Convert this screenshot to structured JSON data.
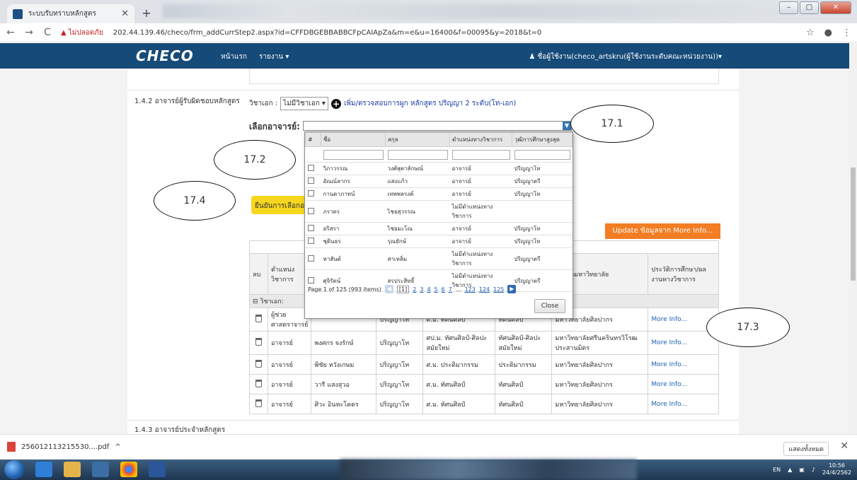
{
  "browser": {
    "tab_title": "ระบบรับทราบหลักสูตร",
    "security_label": "ไม่ปลอดภัย",
    "url": "202.44.139.46/checo/frm_addCurrStep2.aspx?id=CFFDBGEBBABBCFpCAIApZa&m=e&u=16400&f=00095&y=2018&t=0"
  },
  "appnav": {
    "logo": "CHECO",
    "home": "หน้าแรก",
    "report": "รายงาน ▾",
    "user": "ชื่อผู้ใช้งาน(checo_artskru(ผู้ใช้งานระดับคณะหน่วยงาน))▾"
  },
  "section_142": {
    "label": "1.4.2 อาจารย์ผู้รับผิดชอบหลักสูตร",
    "major_prefix": "วิชาเอก :",
    "major_value": "ไม่มีวิชาเอก ▾",
    "check_link": "เพิ่ม/ตรวจสอบการผูก หลักสูตร ปริญญา 2 ระดับ(โท-เอก)",
    "pick_label": "เลือกอาจารย์:",
    "confirm_btn": "ยืนยันการเลือกอาจารย์",
    "update_btn": "Update ข้อมูลจาก More Info..."
  },
  "main_table": {
    "headers": [
      "ลบ",
      "ตำแหน่งวิชาการ",
      "",
      "",
      "",
      "",
      "จบจากมหาวิทยาลัย",
      "ประวัติการศึกษา/ผลงานทางวิชาการ"
    ],
    "group": "วิชาเอก:",
    "rows": [
      {
        "position": "ผู้ช่วยศาสตราจารย์",
        "name": "",
        "degree": "ปริญญาโท",
        "major": "ศ.ม. ทัศนศิลป์",
        "field": "ทัศนศิลป์",
        "uni": "มหาวิทยาลัยศิลปากร",
        "more": "More Info..."
      },
      {
        "position": "อาจารย์",
        "name": "พงศกร จงรักษ์",
        "degree": "ปริญญาโท",
        "major": "ศป.ม. ทัศนศิลป์-ศิลปะสมัยใหม่",
        "field": "ทัศนศิลป์-ศิลปะสมัยใหม่",
        "uni": "มหาวิทยาลัยศรีนครินทรวิโรฒประสานมิตร",
        "more": "More Info..."
      },
      {
        "position": "อาจารย์",
        "name": "พิชัย หวังเกษม",
        "degree": "ปริญญาโท",
        "major": "ศ.ม. ประติมากรรม",
        "field": "ประติมากรรม",
        "uni": "มหาวิทยาลัยศิลปากร",
        "more": "More Info..."
      },
      {
        "position": "อาจารย์",
        "name": "วารี แสงสุวอ",
        "degree": "ปริญญาโท",
        "major": "ศ.ม. ทัศนศิลป์",
        "field": "ทัศนศิลป์",
        "uni": "มหาวิทยาลัยศิลปากร",
        "more": "More Info..."
      },
      {
        "position": "อาจารย์",
        "name": "ศิวะ อินทะโคตร",
        "degree": "ปริญญาโท",
        "major": "ศ.ม. ทัศนศิลป์",
        "field": "ทัศนศิลป์",
        "uni": "มหาวิทยาลัยศิลปากร",
        "more": "More Info..."
      }
    ]
  },
  "popup": {
    "headers": [
      "#",
      "ชื่อ",
      "สกุล",
      "ตำแหน่งทางวิชาการ",
      "วุฒิการศึกษาสูงสุด"
    ],
    "rows": [
      {
        "first": "วิภาวรรณ",
        "last": "วงศ์สุตาลักษณ์",
        "pos": "อาจารย์",
        "deg": "ปริญญาโท"
      },
      {
        "first": "อัณณ์ลากร",
        "last": "แสงแก้ว",
        "pos": "อาจารย์",
        "deg": "ปริญญาตรี"
      },
      {
        "first": "กานดาภาทน์",
        "last": "เทพพลรงค์",
        "pos": "อาจารย์",
        "deg": "ปริญญาโท"
      },
      {
        "first": "ภราดร",
        "last": "ไชยสุวรรณ",
        "pos": "ไม่มีตำแหน่งทางวิชาการ",
        "deg": ""
      },
      {
        "first": "อริสรา",
        "last": "ไชยมะโณ",
        "pos": "อาจารย์",
        "deg": "ปริญญาโท"
      },
      {
        "first": "ชุตินธร",
        "last": "รุณยักษ์",
        "pos": "อาจารย์",
        "deg": "ปริญญาโท"
      },
      {
        "first": "หาสันต์",
        "last": "สาเหลิ่ม",
        "pos": "ไม่มีตำแหน่งทางวิชาการ",
        "deg": "ปริญญาตรี"
      },
      {
        "first": "ศุจิรัตน์",
        "last": "สรประสิทธิ์",
        "pos": "ไม่มีตำแหน่งทางวิชาการ",
        "deg": "ปริญญาตรี"
      }
    ],
    "pager_info": "Page 1 of 125 (993 items)",
    "pages": [
      "[1]",
      "2",
      "3",
      "4",
      "5",
      "6",
      "7",
      "...",
      "123",
      "124",
      "125"
    ],
    "close": "Close"
  },
  "callouts": [
    "17.1",
    "17.2",
    "17.3",
    "17.4"
  ],
  "section_143": "1.4.3 อาจารย์ประจำหลักสูตร",
  "downloads": {
    "file": "256012113215530....pdf",
    "show_all": "แสดงทั้งหมด"
  },
  "taskbar": {
    "lang": "EN",
    "time": "10:56",
    "date": "24/4/2562"
  },
  "colors": {
    "nav": "#164a78",
    "confirm": "#f6d71e",
    "update": "#f27d22"
  }
}
